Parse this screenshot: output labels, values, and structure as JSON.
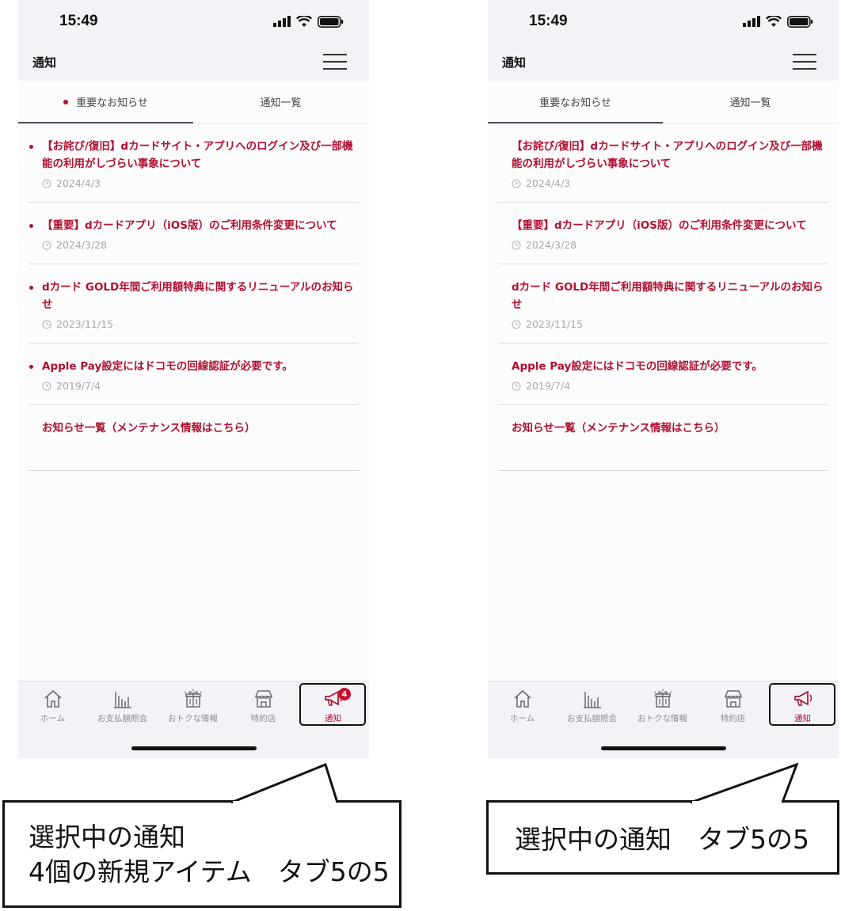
{
  "screens": [
    {
      "status": {
        "time": "15:49"
      },
      "header": {
        "title": "通知"
      },
      "tabs": [
        {
          "label": "重要なお知らせ",
          "dot": true
        },
        {
          "label": "通知一覧"
        }
      ],
      "items": [
        {
          "title": "【お詫び/復旧】dカードサイト・アプリへのログイン及び一部機能の利用がしづらい事象について",
          "date": "2024/4/3"
        },
        {
          "title": "【重要】dカードアプリ（iOS版）のご利用条件変更について",
          "date": "2024/3/28"
        },
        {
          "title": "dカード GOLD年間ご利用額特典に関するリニューアルのお知らせ",
          "date": "2023/11/15"
        },
        {
          "title": "Apple Pay設定にはドコモの回線認証が必要です。",
          "date": "2019/7/4"
        },
        {
          "title": "お知らせ一覧（メンテナンス情報はこちら）"
        }
      ],
      "nav": [
        {
          "label": "ホーム",
          "icon": "home-icon"
        },
        {
          "label": "お支払額照会",
          "icon": "bar-chart-icon"
        },
        {
          "label": "おトクな情報",
          "icon": "gift-icon"
        },
        {
          "label": "特約店",
          "icon": "store-icon"
        },
        {
          "label": "通知",
          "icon": "megaphone-icon",
          "badge": "4"
        }
      ],
      "callout": {
        "line1": "選択中の通知",
        "line2": "4個の新規アイテム　タブ5の5"
      }
    },
    {
      "status": {
        "time": "15:49"
      },
      "header": {
        "title": "通知"
      },
      "tabs": [
        {
          "label": "重要なお知らせ"
        },
        {
          "label": "通知一覧"
        }
      ],
      "items": [
        {
          "title": "【お詫び/復旧】dカードサイト・アプリへのログイン及び一部機能の利用がしづらい事象について",
          "date": "2024/4/3"
        },
        {
          "title": "【重要】dカードアプリ（iOS版）のご利用条件変更について",
          "date": "2024/3/28"
        },
        {
          "title": "dカード GOLD年間ご利用額特典に関するリニューアルのお知らせ",
          "date": "2023/11/15"
        },
        {
          "title": "Apple Pay設定にはドコモの回線認証が必要です。",
          "date": "2019/7/4"
        },
        {
          "title": "お知らせ一覧（メンテナンス情報はこちら）"
        }
      ],
      "nav": [
        {
          "label": "ホーム",
          "icon": "home-icon"
        },
        {
          "label": "お支払額照会",
          "icon": "bar-chart-icon"
        },
        {
          "label": "おトクな情報",
          "icon": "gift-icon"
        },
        {
          "label": "特約店",
          "icon": "store-icon"
        },
        {
          "label": "通知",
          "icon": "megaphone-icon"
        }
      ],
      "callout": {
        "line1": "選択中の通知　タブ5の5"
      }
    }
  ],
  "colors": {
    "accent": "#b0102f",
    "muted": "#a6a6ac",
    "badge": "#c8102e"
  }
}
